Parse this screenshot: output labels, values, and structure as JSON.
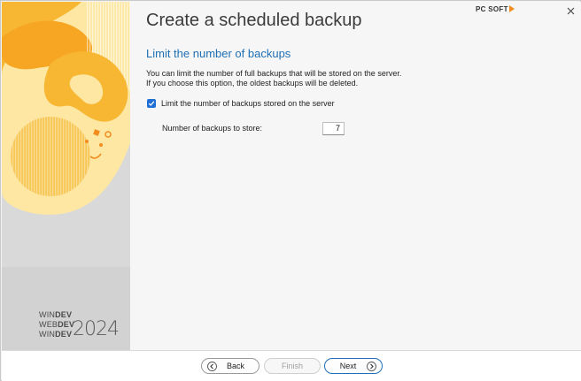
{
  "window": {
    "title": "Create a scheduled backup",
    "brand": "PC SOFT",
    "close_icon": "close-icon"
  },
  "sidebar": {
    "product_lines": [
      "WIN",
      "DEV",
      "WEB",
      "DEV",
      "WIN",
      "DEV"
    ],
    "year": "2024",
    "colors": {
      "primary": "#f7b733",
      "light": "#fde7a3",
      "accent": "#f28c1e"
    }
  },
  "section": {
    "title": "Limit the number of backups",
    "description_line1": "You can limit the number of full backups that will be stored on the server.",
    "description_line2": "If you choose this option, the oldest backups will be deleted."
  },
  "limit_option": {
    "label": "Limit the number of backups stored on the server",
    "checked": true
  },
  "backups_count": {
    "label": "Number of backups to store:",
    "value": "7"
  },
  "footer": {
    "back_label": "Back",
    "finish_label": "Finish",
    "next_label": "Next",
    "finish_enabled": false
  },
  "colors": {
    "accent": "#1f6fb5",
    "checkbox": "#1f6fd6"
  }
}
